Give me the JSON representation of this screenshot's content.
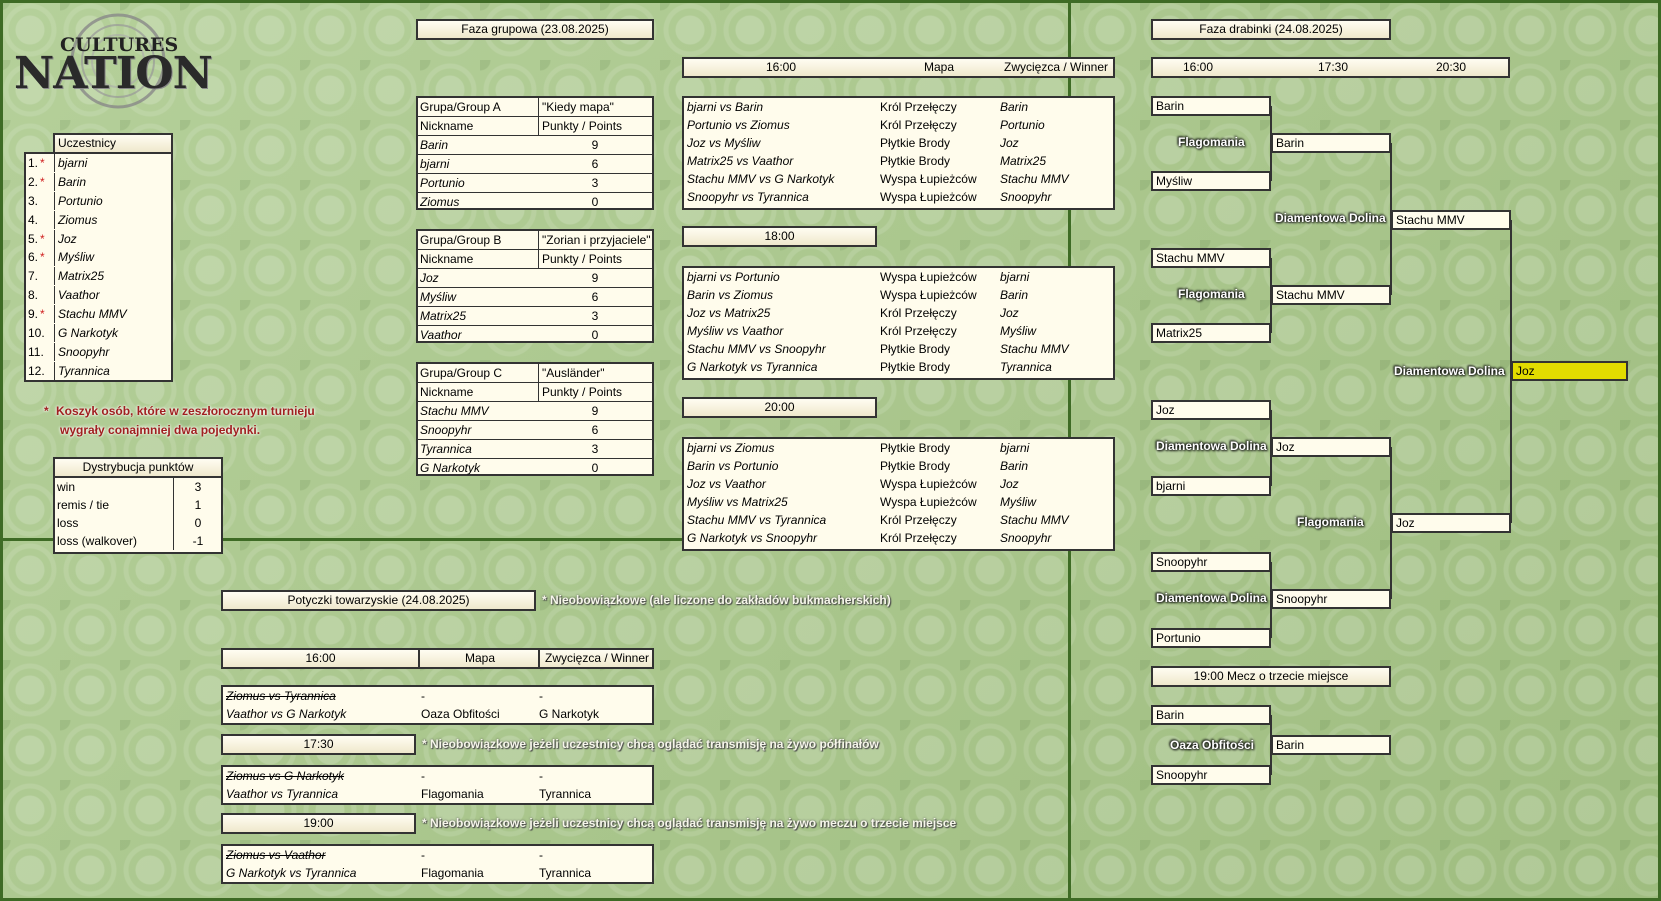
{
  "logo": {
    "top": "CULTURES",
    "bottom": "NATION"
  },
  "participants": {
    "title": "Uczestnicy",
    "items": [
      {
        "num": "1.",
        "star": "*",
        "name": "bjarni"
      },
      {
        "num": "2.",
        "star": "*",
        "name": "Barin"
      },
      {
        "num": "3.",
        "star": "",
        "name": "Portunio"
      },
      {
        "num": "4.",
        "star": "",
        "name": "Ziomus"
      },
      {
        "num": "5.",
        "star": "*",
        "name": "Joz"
      },
      {
        "num": "6.",
        "star": "*",
        "name": "Myśliw"
      },
      {
        "num": "7.",
        "star": "",
        "name": "Matrix25"
      },
      {
        "num": "8.",
        "star": "",
        "name": "Vaathor"
      },
      {
        "num": "9.",
        "star": "*",
        "name": "Stachu MMV"
      },
      {
        "num": "10.",
        "star": "",
        "name": "G Narkotyk"
      },
      {
        "num": "11.",
        "star": "",
        "name": "Snoopyhr"
      },
      {
        "num": "12.",
        "star": "",
        "name": "Tyrannica"
      }
    ],
    "note_star": "*",
    "note_line1": "Koszyk osób, które w zeszłorocznym turnieju",
    "note_line2": "wygrały conajmniej dwa pojedynki."
  },
  "points": {
    "title": "Dystrybucja punktów",
    "rows": [
      {
        "label": "win",
        "value": "3"
      },
      {
        "label": "remis / tie",
        "value": "1"
      },
      {
        "label": "loss",
        "value": "0"
      },
      {
        "label": "loss (walkover)",
        "value": "-1"
      }
    ]
  },
  "group_phase": {
    "title": "Faza grupowa (23.08.2025)",
    "groups": [
      {
        "label": "Grupa/Group A",
        "name": "\"Kiedy mapa\"",
        "col1": "Nickname",
        "col2": "Punkty / Points",
        "rows": [
          {
            "n": "Barin",
            "p": "9"
          },
          {
            "n": "bjarni",
            "p": "6"
          },
          {
            "n": "Portunio",
            "p": "3"
          },
          {
            "n": "Ziomus",
            "p": "0"
          }
        ]
      },
      {
        "label": "Grupa/Group B",
        "name": "\"Zorian i przyjaciele\"",
        "col1": "Nickname",
        "col2": "Punkty / Points",
        "rows": [
          {
            "n": "Joz",
            "p": "9"
          },
          {
            "n": "Myśliw",
            "p": "6"
          },
          {
            "n": "Matrix25",
            "p": "3"
          },
          {
            "n": "Vaathor",
            "p": "0"
          }
        ]
      },
      {
        "label": "Grupa/Group C",
        "name": "\"Ausländer\"",
        "col1": "Nickname",
        "col2": "Punkty / Points",
        "rows": [
          {
            "n": "Stachu MMV",
            "p": "9"
          },
          {
            "n": "Snoopyhr",
            "p": "6"
          },
          {
            "n": "Tyrannica",
            "p": "3"
          },
          {
            "n": "G Narkotyk",
            "p": "0"
          }
        ]
      }
    ],
    "header": {
      "time": "16:00",
      "map": "Mapa",
      "winner": "Zwycięzca / Winner"
    },
    "sessions": [
      {
        "time": "16:00",
        "matches": [
          {
            "m": "bjarni vs Barin",
            "map": "Król Przełęczy",
            "w": "Barin"
          },
          {
            "m": "Portunio vs Ziomus",
            "map": "Król Przełęczy",
            "w": "Portunio"
          },
          {
            "m": "Joz vs Myśliw",
            "map": "Płytkie Brody",
            "w": "Joz"
          },
          {
            "m": "Matrix25 vs Vaathor",
            "map": "Płytkie Brody",
            "w": "Matrix25"
          },
          {
            "m": "Stachu MMV vs G Narkotyk",
            "map": "Wyspa Łupieżców",
            "w": "Stachu MMV"
          },
          {
            "m": "Snoopyhr vs Tyrannica",
            "map": "Wyspa Łupieżców",
            "w": "Snoopyhr"
          }
        ]
      },
      {
        "time": "18:00",
        "matches": [
          {
            "m": "bjarni vs Portunio",
            "map": "Wyspa Łupieżców",
            "w": "bjarni"
          },
          {
            "m": "Barin vs Ziomus",
            "map": "Wyspa Łupieżców",
            "w": "Barin"
          },
          {
            "m": "Joz vs Matrix25",
            "map": "Król Przełęczy",
            "w": "Joz"
          },
          {
            "m": "Myśliw vs Vaathor",
            "map": "Król Przełęczy",
            "w": "Myśliw"
          },
          {
            "m": "Stachu MMV vs Snoopyhr",
            "map": "Płytkie Brody",
            "w": "Stachu MMV"
          },
          {
            "m": "G Narkotyk vs Tyrannica",
            "map": "Płytkie Brody",
            "w": "Tyrannica"
          }
        ]
      },
      {
        "time": "20:00",
        "matches": [
          {
            "m": "bjarni vs Ziomus",
            "map": "Płytkie Brody",
            "w": "bjarni"
          },
          {
            "m": "Barin vs Portunio",
            "map": "Płytkie Brody",
            "w": "Barin"
          },
          {
            "m": "Joz vs Vaathor",
            "map": "Wyspa Łupieżców",
            "w": "Joz"
          },
          {
            "m": "Myśliw vs Matrix25",
            "map": "Wyspa Łupieżców",
            "w": "Myśliw"
          },
          {
            "m": "Stachu MMV vs Tyrannica",
            "map": "Król Przełęczy",
            "w": "Stachu MMV"
          },
          {
            "m": "G Narkotyk vs Snoopyhr",
            "map": "Król Przełęczy",
            "w": "Snoopyhr"
          }
        ]
      }
    ]
  },
  "friendly": {
    "title": "Potyczki towarzyskie (24.08.2025)",
    "note": "* Nieobowiązkowe (ale liczone do zakładów bukmacherskich)",
    "header": {
      "time": "16:00",
      "map": "Mapa",
      "winner": "Zwycięzca / Winner"
    },
    "sessions": [
      {
        "time": "16:00",
        "note": "",
        "matches": [
          {
            "m": "Ziomus vs Tyrannica",
            "map": "-",
            "w": "-",
            "strike": true
          },
          {
            "m": "Vaathor vs G Narkotyk",
            "map": "Oaza Obfitości",
            "w": "G Narkotyk",
            "strike": false
          }
        ]
      },
      {
        "time": "17:30",
        "note": "* Nieobowiązkowe jeżeli uczestnicy chcą oglądać transmisję na żywo półfinałów",
        "matches": [
          {
            "m": "Ziomus vs G Narkotyk",
            "map": "-",
            "w": "-",
            "strike": true
          },
          {
            "m": "Vaathor vs Tyrannica",
            "map": "Flagomania",
            "w": "Tyrannica",
            "strike": false
          }
        ]
      },
      {
        "time": "19:00",
        "note": "* Nieobowiązkowe jeżeli uczestnicy chcą oglądać transmisję na żywo meczu o trzecie miejsce",
        "matches": [
          {
            "m": "Ziomus vs Vaathor",
            "map": "-",
            "w": "-",
            "strike": true
          },
          {
            "m": "G Narkotyk vs Tyrannica",
            "map": "Flagomania",
            "w": "Tyrannica",
            "strike": false
          }
        ]
      }
    ]
  },
  "ladder": {
    "title": "Faza drabinki (24.08.2025)",
    "times": [
      "16:00",
      "17:30",
      "20:30"
    ],
    "r1": [
      "Barin",
      "Myśliw",
      "Stachu MMV",
      "Matrix25",
      "Joz",
      "bjarni",
      "Snoopyhr",
      "Portunio"
    ],
    "r1_maps": [
      "Flagomania",
      "Flagomania",
      "Diamentowa Dolina",
      "Diamentowa Dolina"
    ],
    "r2": [
      "Barin",
      "Stachu MMV",
      "Joz",
      "Snoopyhr"
    ],
    "r2_maps": [
      "Diamentowa Dolina",
      "Flagomania"
    ],
    "r3": [
      "Stachu MMV",
      "Joz"
    ],
    "final_map": "Diamentowa Dolina",
    "champion": "Joz",
    "third": {
      "title": "19:00 Mecz o trzecie miejsce",
      "p1": "Barin",
      "p2": "Snoopyhr",
      "map": "Oaza Obfitości",
      "winner": "Barin"
    }
  }
}
